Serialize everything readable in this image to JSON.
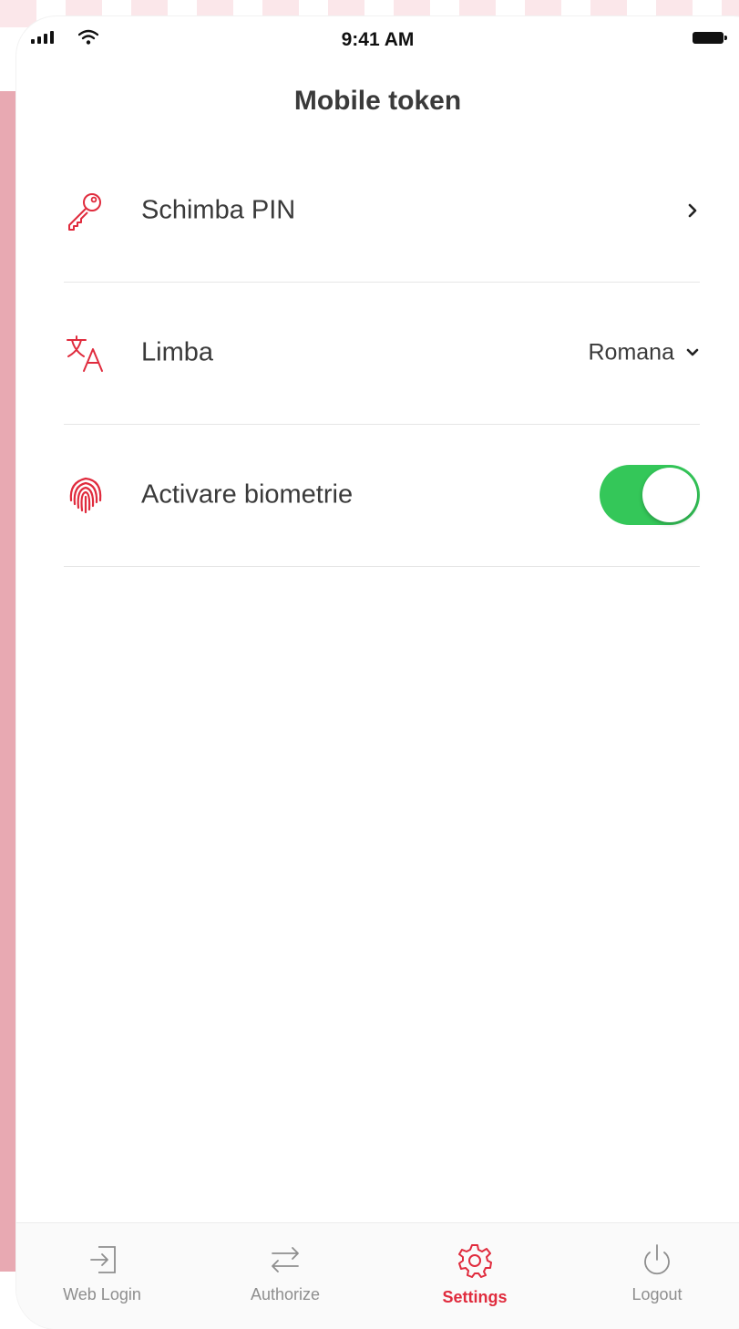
{
  "status_bar": {
    "time": "9:41 AM"
  },
  "header": {
    "title": "Mobile token"
  },
  "settings": {
    "change_pin": {
      "label": "Schimba PIN",
      "icon": "key-icon"
    },
    "language": {
      "label": "Limba",
      "value": "Romana",
      "icon": "translate-icon"
    },
    "biometrics": {
      "label": "Activare biometrie",
      "enabled": true,
      "icon": "fingerprint-icon"
    }
  },
  "tab_bar": {
    "tabs": [
      {
        "label": "Web Login",
        "icon": "login-icon",
        "active": false
      },
      {
        "label": "Authorize",
        "icon": "swap-arrows-icon",
        "active": false
      },
      {
        "label": "Settings",
        "icon": "gear-icon",
        "active": true
      },
      {
        "label": "Logout",
        "icon": "power-icon",
        "active": false
      }
    ]
  },
  "colors": {
    "accent": "#e02b3d",
    "toggle_on": "#34c759",
    "inactive": "#8e8e8e",
    "text": "#3a3a3a"
  }
}
